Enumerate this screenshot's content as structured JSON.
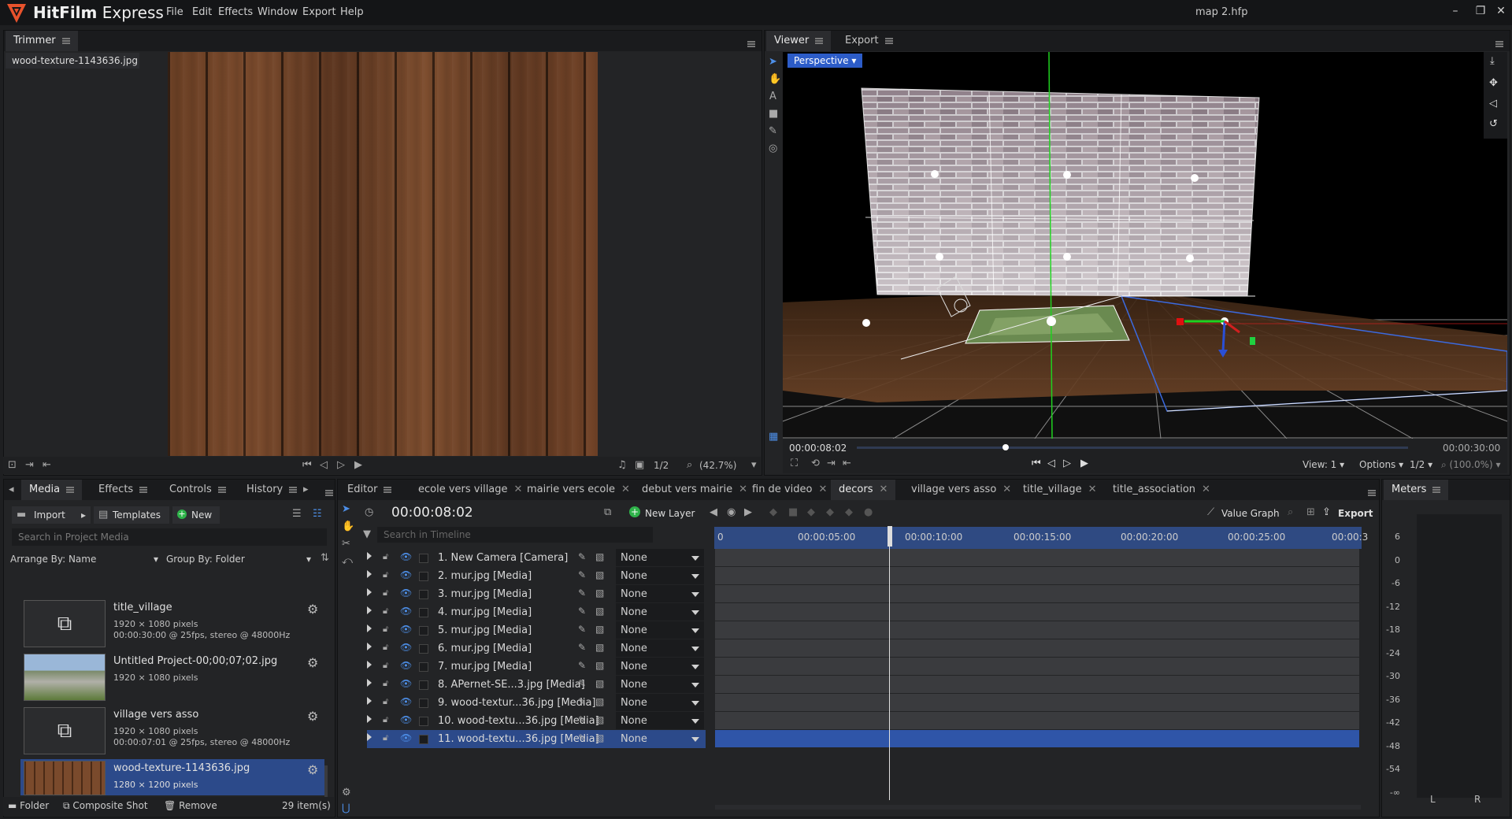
{
  "app": {
    "brand": "HitFilm",
    "edition": "Express",
    "project_title": "map 2.hfp"
  },
  "menu": [
    "File",
    "Edit",
    "Effects",
    "Window",
    "Export",
    "Help"
  ],
  "trimmer": {
    "tab": "Trimmer",
    "file_tab": "wood-texture-1143636.jpg",
    "zoom_fraction": "1/2",
    "zoom_percent": "(42.7%)"
  },
  "viewer": {
    "tabs": [
      "Viewer",
      "Export"
    ],
    "camera_mode": "Perspective",
    "current_time": "00:00:08:02",
    "end_time": "00:00:30:00",
    "view_label": "View: 1",
    "options_label": "Options",
    "resolution": "1/2",
    "zoom": "(100.0%)",
    "playhead_fraction": 0.27
  },
  "media_panel": {
    "tabs": [
      "Media",
      "Effects",
      "Controls",
      "History"
    ],
    "import_label": "Import",
    "templates_label": "Templates",
    "new_label": "New",
    "search_placeholder": "Search in Project Media",
    "arrange_by": "Arrange By: Name",
    "group_by": "Group By: Folder",
    "items": [
      {
        "name": "title_village",
        "line1": "1920 × 1080 pixels",
        "line2": "00:00:30:00 @ 25fps, stereo @ 48000Hz",
        "thumb": "composite"
      },
      {
        "name": "Untitled Project-00;00;07;02.jpg",
        "line1": "1920 × 1080 pixels",
        "line2": "",
        "thumb": "photo"
      },
      {
        "name": "village vers asso",
        "line1": "1920 × 1080 pixels",
        "line2": "00:00:07:01 @ 25fps, stereo @ 48000Hz",
        "thumb": "composite"
      },
      {
        "name": "wood-texture-1143636.jpg",
        "line1": "1280 × 1200 pixels",
        "line2": "",
        "thumb": "wood"
      }
    ],
    "footer": {
      "folder": "Folder",
      "composite": "Composite Shot",
      "remove": "Remove",
      "count": "29 item(s)"
    }
  },
  "editor": {
    "tabs": [
      "Editor",
      "ecole vers village",
      "mairie vers ecole",
      "debut vers mairie",
      "fin de video",
      "decors",
      "village vers asso",
      "title_village",
      "title_association"
    ],
    "active_tab": "decors",
    "timecode": "00:00:08:02",
    "new_layer_label": "New Layer",
    "search_placeholder": "Search in Timeline",
    "value_graph_label": "Value Graph",
    "export_label": "Export",
    "ruler": [
      "0",
      "00:00:05:00",
      "00:00:10:00",
      "00:00:15:00",
      "00:00:20:00",
      "00:00:25:00",
      "00:00:3"
    ],
    "layers": [
      {
        "name": "1. New Camera [Camera]",
        "blend": "None"
      },
      {
        "name": "2. mur.jpg [Media]",
        "blend": "None"
      },
      {
        "name": "3. mur.jpg [Media]",
        "blend": "None"
      },
      {
        "name": "4. mur.jpg [Media]",
        "blend": "None"
      },
      {
        "name": "5. mur.jpg [Media]",
        "blend": "None"
      },
      {
        "name": "6. mur.jpg [Media]",
        "blend": "None"
      },
      {
        "name": "7. mur.jpg [Media]",
        "blend": "None"
      },
      {
        "name": "8. APernet-SE...3.jpg [Media]",
        "blend": "None"
      },
      {
        "name": "9. wood-textur...36.jpg [Media]",
        "blend": "None"
      },
      {
        "name": "10. wood-textu...36.jpg [Media]",
        "blend": "None"
      },
      {
        "name": "11. wood-textu...36.jpg [Media]",
        "blend": "None"
      }
    ],
    "selected_layer_index": 10
  },
  "meters": {
    "tab": "Meters",
    "scale": [
      "6",
      "0",
      "-6",
      "-12",
      "-18",
      "-24",
      "-30",
      "-36",
      "-42",
      "-48",
      "-54",
      "-∞"
    ],
    "channels": [
      "L",
      "R"
    ]
  },
  "colors": {
    "accent": "#2c4a8a",
    "brand": "#e8522c",
    "selected_track": "#2f55a8"
  }
}
